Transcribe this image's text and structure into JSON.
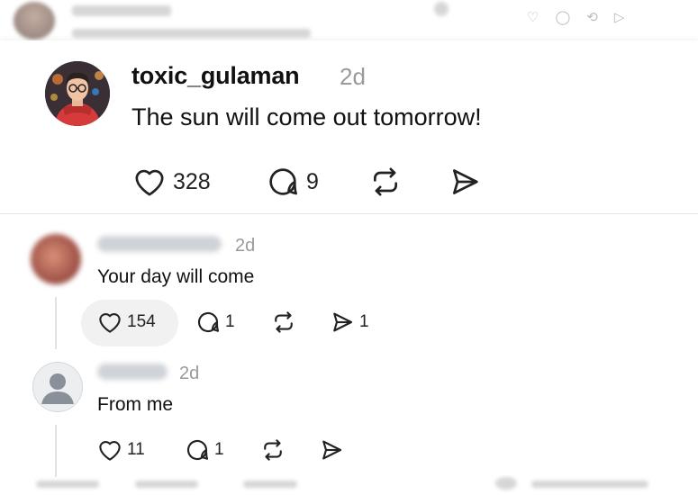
{
  "background_top": {
    "icons": [
      "heart-icon",
      "comment-icon",
      "repost-icon",
      "share-icon"
    ]
  },
  "post": {
    "username": "toxic_gulaman",
    "time": "2d",
    "text": "The sun will come out tomorrow!",
    "likes": "328",
    "comments": "9"
  },
  "replies": [
    {
      "time": "2d",
      "text": "Your day will come",
      "likes": "154",
      "comments": "1",
      "shares": "1"
    },
    {
      "time": "2d",
      "text": "From me",
      "likes": "11",
      "comments": "1"
    }
  ]
}
